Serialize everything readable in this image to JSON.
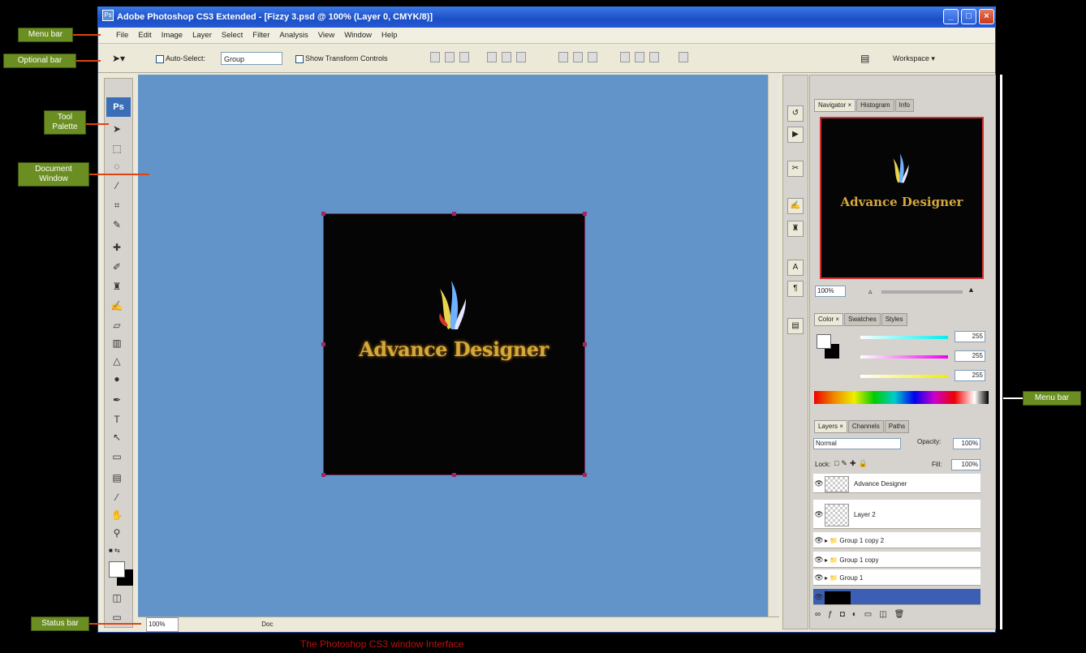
{
  "window": {
    "title": "Adobe Photoshop CS3 Extended - [Fizzy 3.psd @ 100% (Layer 0, CMYK/8)]",
    "app_icon": "Ps"
  },
  "menu": [
    "File",
    "Edit",
    "Image",
    "Layer",
    "Select",
    "Filter",
    "Analysis",
    "View",
    "Window",
    "Help"
  ],
  "options": {
    "auto_select": "Auto-Select:",
    "auto_select_value": "Group",
    "show_transform": "Show Transform Controls",
    "workspace": "Workspace ▾"
  },
  "toolbox": {
    "logo": "Ps"
  },
  "document": {
    "title_text": "Advance Designer"
  },
  "status": {
    "zoom": "100%",
    "info": "Doc"
  },
  "panels": {
    "nav_tabs": [
      "Navigator ×",
      "Histogram",
      "Info"
    ],
    "nav_zoom": "100%",
    "color_tabs": [
      "Color ×",
      "Swatches",
      "Styles"
    ],
    "color_values": [
      "255",
      "255",
      "255"
    ],
    "layer_tabs": [
      "Layers ×",
      "Channels",
      "Paths"
    ],
    "blend_mode": "Normal",
    "opacity_label": "Opacity:",
    "opacity": "100%",
    "lock_label": "Lock:",
    "fill_label": "Fill:",
    "fill": "100%",
    "layers": [
      "Advance Designer",
      "Layer 2",
      "Group 1 copy 2",
      "Group 1 copy",
      "Group 1"
    ]
  },
  "annotations": {
    "menu_bar": "Menu bar",
    "options_bar": "Optional bar",
    "tool_palette": "Tool Palette",
    "document_window": "Document Window",
    "status_bar": "Status bar",
    "menu_bar_right": "Menu bar",
    "caption": "The Photoshop CS3 window Interface"
  }
}
